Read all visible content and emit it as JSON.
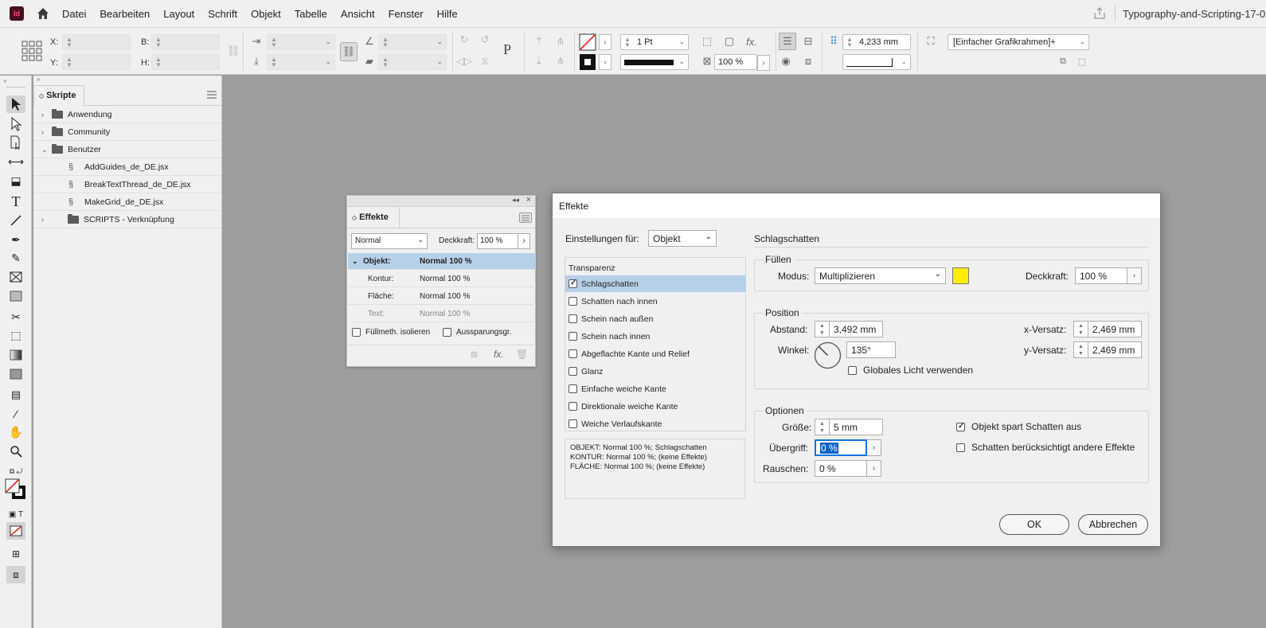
{
  "app": {
    "logo_text": "Id",
    "document_title": "Typography-and-Scripting-17-0"
  },
  "menu": [
    "Datei",
    "Bearbeiten",
    "Layout",
    "Schrift",
    "Objekt",
    "Tabelle",
    "Ansicht",
    "Fenster",
    "Hilfe"
  ],
  "controlbar": {
    "x_label": "X:",
    "y_label": "Y:",
    "b_label": "B:",
    "h_label": "H:",
    "stroke_weight": "1 Pt",
    "scale_percent": "100 %",
    "gap_value": "4,233 mm",
    "frame_style": "[Einfacher Grafikrahmen]+"
  },
  "scripts_panel": {
    "tab_label": "Skripte",
    "items": [
      {
        "label": "Anwendung",
        "type": "folder",
        "expanded": false
      },
      {
        "label": "Community",
        "type": "folder",
        "expanded": false
      },
      {
        "label": "Benutzer",
        "type": "folder",
        "expanded": true
      },
      {
        "label": "AddGuides_de_DE.jsx",
        "type": "script"
      },
      {
        "label": "BreakTextThread_de_DE.jsx",
        "type": "script"
      },
      {
        "label": "MakeGrid_de_DE.jsx",
        "type": "script"
      },
      {
        "label": "SCRIPTS - Verknüpfung",
        "type": "folder",
        "expanded": false
      }
    ]
  },
  "effects_panel": {
    "tab_label": "Effekte",
    "blend_mode": "Normal",
    "opacity_label": "Deckkraft:",
    "opacity_value": "100 %",
    "rows": [
      {
        "key": "Objekt:",
        "value": "Normal 100 %"
      },
      {
        "key": "Kontur:",
        "value": "Normal 100 %"
      },
      {
        "key": "Fläche:",
        "value": "Normal 100 %"
      },
      {
        "key": "Text:",
        "value": "Normal 100 %"
      }
    ],
    "isolate_label": "Füllmeth. isolieren",
    "knockout_label": "Aussparungsgr."
  },
  "dialog": {
    "title": "Effekte",
    "settings_for_label": "Einstellungen für:",
    "settings_for_value": "Objekt",
    "section_title": "Schlagschatten",
    "effects_list_header": "Transparenz",
    "effects": [
      {
        "label": "Schlagschatten",
        "checked": true
      },
      {
        "label": "Schatten nach innen",
        "checked": false
      },
      {
        "label": "Schein nach außen",
        "checked": false
      },
      {
        "label": "Schein nach innen",
        "checked": false
      },
      {
        "label": "Abgeflachte Kante und Relief",
        "checked": false
      },
      {
        "label": "Glanz",
        "checked": false
      },
      {
        "label": "Einfache weiche Kante",
        "checked": false
      },
      {
        "label": "Direktionale weiche Kante",
        "checked": false
      },
      {
        "label": "Weiche Verlaufskante",
        "checked": false
      }
    ],
    "summary": [
      "OBJEKT: Normal 100 %; Schlagschatten",
      "KONTUR: Normal 100 %; (keine Effekte)",
      "FLÄCHE: Normal 100 %; (keine Effekte)"
    ],
    "fill": {
      "group_title": "Füllen",
      "mode_label": "Modus:",
      "mode_value": "Multiplizieren",
      "color": "#ffee00",
      "opacity_label": "Deckkraft:",
      "opacity_value": "100 %"
    },
    "position": {
      "group_title": "Position",
      "distance_label": "Abstand:",
      "distance_value": "3,492 mm",
      "angle_label": "Winkel:",
      "angle_value": "135°",
      "global_light_label": "Globales Licht verwenden",
      "x_offset_label": "x-Versatz:",
      "x_offset_value": "2,469 mm",
      "y_offset_label": "y-Versatz:",
      "y_offset_value": "2,469 mm"
    },
    "options": {
      "group_title": "Optionen",
      "size_label": "Größe:",
      "size_value": "5 mm",
      "spread_label": "Übergriff:",
      "spread_value": "0 %",
      "noise_label": "Rauschen:",
      "noise_value": "0 %",
      "knockout_label": "Objekt spart Schatten aus",
      "honor_effects_label": "Schatten berücksichtigt andere Effekte"
    },
    "ok_label": "OK",
    "cancel_label": "Abbrechen"
  }
}
